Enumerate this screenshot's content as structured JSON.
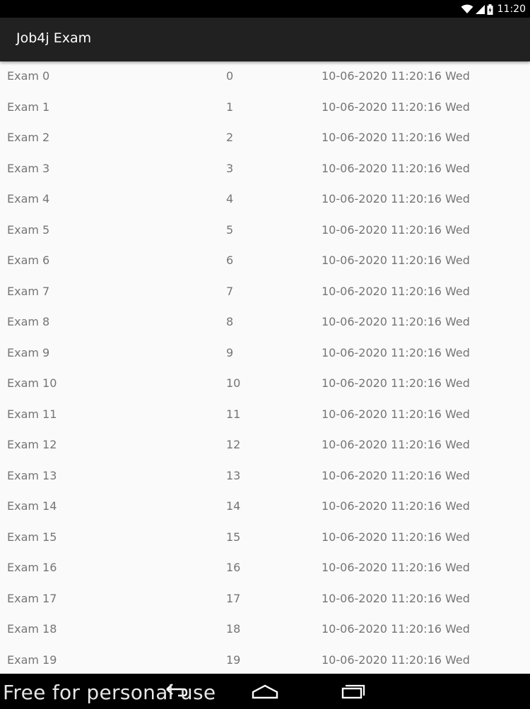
{
  "status_bar": {
    "time": "11:20",
    "icons": [
      "wifi-icon",
      "signal-icon",
      "battery-icon"
    ]
  },
  "app_bar": {
    "title": "Job4j Exam"
  },
  "exams": [
    {
      "name": "Exam 0",
      "number": "0",
      "date": "10-06-2020 11:20:16 Wed"
    },
    {
      "name": "Exam 1",
      "number": "1",
      "date": "10-06-2020 11:20:16 Wed"
    },
    {
      "name": "Exam 2",
      "number": "2",
      "date": "10-06-2020 11:20:16 Wed"
    },
    {
      "name": "Exam 3",
      "number": "3",
      "date": "10-06-2020 11:20:16 Wed"
    },
    {
      "name": "Exam 4",
      "number": "4",
      "date": "10-06-2020 11:20:16 Wed"
    },
    {
      "name": "Exam 5",
      "number": "5",
      "date": "10-06-2020 11:20:16 Wed"
    },
    {
      "name": "Exam 6",
      "number": "6",
      "date": "10-06-2020 11:20:16 Wed"
    },
    {
      "name": "Exam 7",
      "number": "7",
      "date": "10-06-2020 11:20:16 Wed"
    },
    {
      "name": "Exam 8",
      "number": "8",
      "date": "10-06-2020 11:20:16 Wed"
    },
    {
      "name": "Exam 9",
      "number": "9",
      "date": "10-06-2020 11:20:16 Wed"
    },
    {
      "name": "Exam 10",
      "number": "10",
      "date": "10-06-2020 11:20:16 Wed"
    },
    {
      "name": "Exam 11",
      "number": "11",
      "date": "10-06-2020 11:20:16 Wed"
    },
    {
      "name": "Exam 12",
      "number": "12",
      "date": "10-06-2020 11:20:16 Wed"
    },
    {
      "name": "Exam 13",
      "number": "13",
      "date": "10-06-2020 11:20:16 Wed"
    },
    {
      "name": "Exam 14",
      "number": "14",
      "date": "10-06-2020 11:20:16 Wed"
    },
    {
      "name": "Exam 15",
      "number": "15",
      "date": "10-06-2020 11:20:16 Wed"
    },
    {
      "name": "Exam 16",
      "number": "16",
      "date": "10-06-2020 11:20:16 Wed"
    },
    {
      "name": "Exam 17",
      "number": "17",
      "date": "10-06-2020 11:20:16 Wed"
    },
    {
      "name": "Exam 18",
      "number": "18",
      "date": "10-06-2020 11:20:16 Wed"
    },
    {
      "name": "Exam 19",
      "number": "19",
      "date": "10-06-2020 11:20:16 Wed"
    }
  ],
  "nav_bar": {
    "buttons": [
      "back-icon",
      "home-icon",
      "recents-icon"
    ],
    "watermark": "Free for personal use"
  },
  "colors": {
    "status_bar": "#000000",
    "app_bar": "#212121",
    "list_background": "#fafafa",
    "list_text": "#757575",
    "nav_bar": "#000000"
  }
}
